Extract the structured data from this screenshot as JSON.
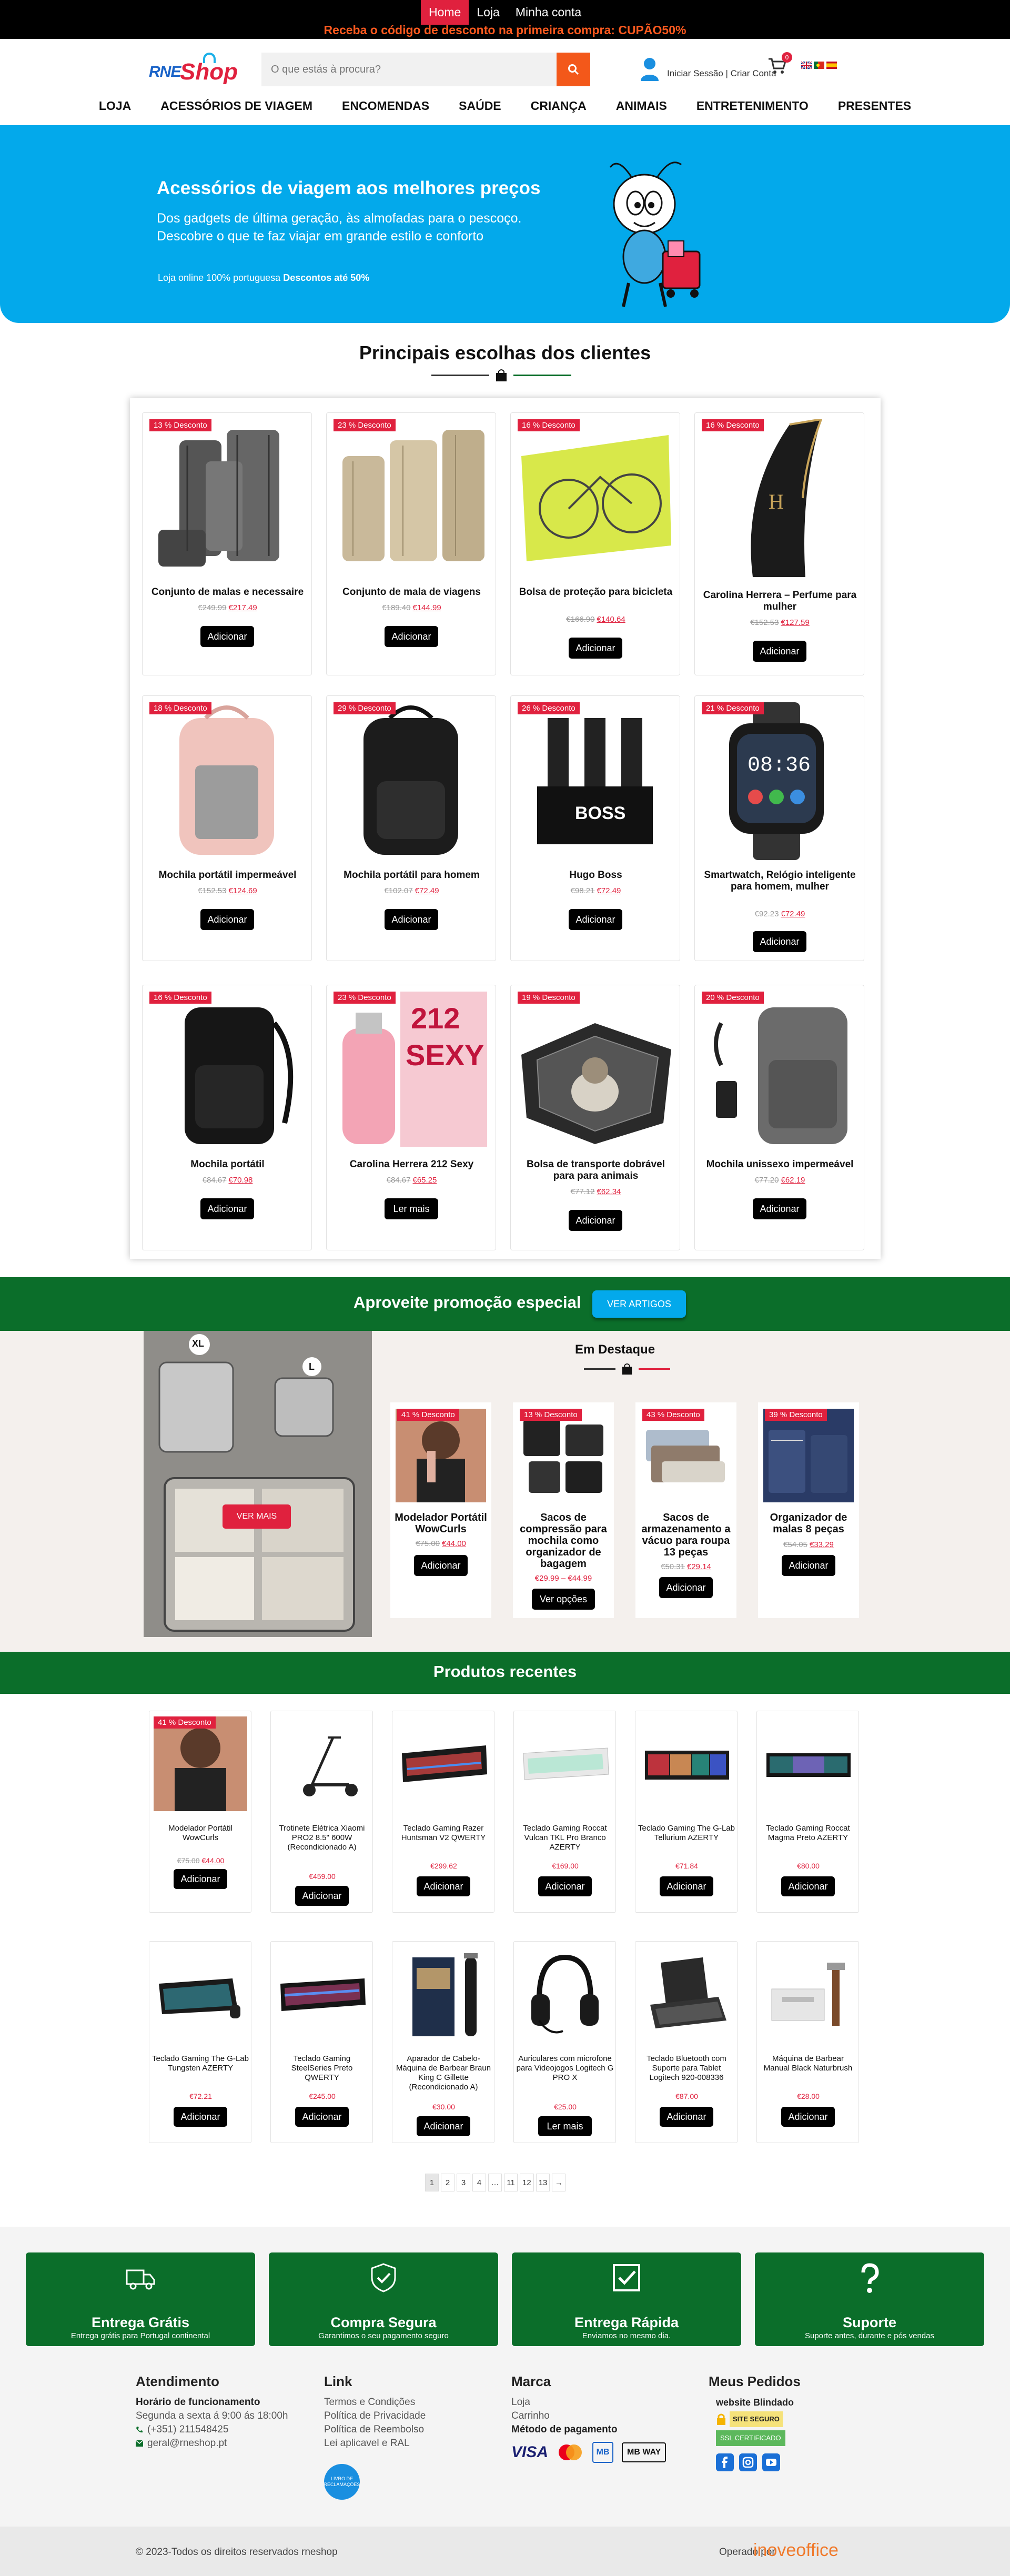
{
  "topbar": {
    "nav": [
      {
        "label": "Home"
      },
      {
        "label": "Loja"
      },
      {
        "label": "Minha conta"
      }
    ],
    "promo": "Receba o código de desconto na primeira compra: CUPÃO50%"
  },
  "header": {
    "logo_rne": "RNE",
    "logo_shop": "Shop",
    "search_placeholder": "O que estás à procura?",
    "account_text": "Iniciar Sessão | Criar Conta",
    "cart_count": "0"
  },
  "mainnav": [
    "LOJA",
    "ACESSÓRIOS DE VIAGEM",
    "ENCOMENDAS",
    "SAÚDE",
    "CRIANÇA",
    "ANIMAIS",
    "ENTRETENIMENTO",
    "PRESENTES"
  ],
  "hero": {
    "title": "Acessórios de viagem aos melhores preços",
    "subtitle": "Dos gadgets de última geração, às almofadas para o pescoço. Descobre o que te faz viajar em grande estilo e conforto",
    "note_prefix": "Loja online 100% portuguesa",
    "note_bold": "Descontos até 50%",
    "accent": "#03a9eb"
  },
  "top_picks": {
    "title": "Principais escolhas dos clientes",
    "products": [
      {
        "discount": "13 % Desconto",
        "name": "Conjunto de malas e necessaire",
        "old": "€249.99",
        "new": "€217.49",
        "button": "Adicionar"
      },
      {
        "discount": "23 % Desconto",
        "name": "Conjunto de mala de viagens",
        "old": "€189.40",
        "new": "€144.99",
        "button": "Adicionar"
      },
      {
        "discount": "16 % Desconto",
        "name": "Bolsa de proteção para bicicleta",
        "old": "€166.90",
        "new": "€140.64",
        "button": "Adicionar"
      },
      {
        "discount": "16 % Desconto",
        "name": "Carolina Herrera – Perfume para mulher",
        "old": "€152.53",
        "new": "€127.59",
        "button": "Adicionar"
      },
      {
        "discount": "18 % Desconto",
        "name": "Mochila portátil impermeável",
        "old": "€152.53",
        "new": "€124.69",
        "button": "Adicionar"
      },
      {
        "discount": "29 % Desconto",
        "name": "Mochila portátil para homem",
        "old": "€102.07",
        "new": "€72.49",
        "button": "Adicionar"
      },
      {
        "discount": "26 % Desconto",
        "name": "Hugo Boss",
        "old": "€98.21",
        "new": "€72.49",
        "button": "Adicionar"
      },
      {
        "discount": "21 % Desconto",
        "name": "Smartwatch, Relógio inteligente para homem, mulher",
        "old": "€92.23",
        "new": "€72.49",
        "button": "Adicionar"
      },
      {
        "discount": "16 % Desconto",
        "name": "Mochila portátil",
        "old": "€84.67",
        "new": "€70.98",
        "button": "Adicionar"
      },
      {
        "discount": "23 % Desconto",
        "name": "Carolina Herrera 212 Sexy",
        "old": "€84.67",
        "new": "€65.25",
        "button": "Ler mais"
      },
      {
        "discount": "19 % Desconto",
        "name": "Bolsa de transporte dobrável para para animais",
        "old": "€77.12",
        "new": "€62.34",
        "button": "Adicionar"
      },
      {
        "discount": "20 % Desconto",
        "name": "Mochila unissexo impermeável",
        "old": "€77.20",
        "new": "€62.19",
        "button": "Adicionar"
      }
    ]
  },
  "promo_band": {
    "title": "Aproveite promoção especial",
    "button": "VER ARTIGOS"
  },
  "featured": {
    "title": "Em Destaque",
    "image_button": "VER MAIS",
    "size_xl": "XL",
    "size_l": "L",
    "products": [
      {
        "discount": "41 % Desconto",
        "name": "Modelador Portátil WowCurls",
        "old": "€75.00",
        "new": "€44.00",
        "button": "Adicionar"
      },
      {
        "discount": "13 % Desconto",
        "name": "Sacos de compressão para mochila como organizador de bagagem",
        "price": "€29.99 – €44.99",
        "button": "Ver opções"
      },
      {
        "discount": "43 % Desconto",
        "name": "Sacos de armazenamento a vácuo para roupa 13 peças",
        "old": "€50.31",
        "new": "€29.14",
        "button": "Adicionar"
      },
      {
        "discount": "39 % Desconto",
        "name": "Organizador de malas 8 peças",
        "old": "€54.05",
        "new": "€33.29",
        "button": "Adicionar"
      }
    ]
  },
  "recent": {
    "title": "Produtos recentes",
    "products": [
      {
        "discount": "41 % Desconto",
        "name": "Modelador Portátil WowCurls",
        "old": "€75.00",
        "new": "€44.00",
        "button": "Adicionar"
      },
      {
        "name": "Trotinete Elétrica Xiaomi PRO2 8.5\" 600W (Recondicionado A)",
        "price": "€459.00",
        "button": "Adicionar"
      },
      {
        "name": "Teclado Gaming Razer Huntsman V2 QWERTY",
        "price": "€299.62",
        "button": "Adicionar"
      },
      {
        "name": "Teclado Gaming Roccat Vulcan TKL Pro Branco AZERTY",
        "price": "€169.00",
        "button": "Adicionar"
      },
      {
        "name": "Teclado Gaming The G-Lab Tellurium AZERTY",
        "price": "€71.84",
        "button": "Adicionar"
      },
      {
        "name": "Teclado Gaming Roccat Magma Preto AZERTY",
        "price": "€80.00",
        "button": "Adicionar"
      },
      {
        "name": "Teclado Gaming The G-Lab Tungsten AZERTY",
        "price": "€72.21",
        "button": "Adicionar"
      },
      {
        "name": "Teclado Gaming SteelSeries Preto QWERTY",
        "price": "€245.00",
        "button": "Adicionar"
      },
      {
        "name": "Aparador de Cabelo-Máquina de Barbear Braun King C Gillette (Recondicionado A)",
        "price": "€30.00",
        "button": "Adicionar"
      },
      {
        "name": "Auriculares com microfone para Videojogos Logitech G PRO X",
        "price": "€25.00",
        "button": "Ler mais"
      },
      {
        "name": "Teclado Bluetooth com Suporte para Tablet Logitech 920-008336",
        "price": "€87.00",
        "button": "Adicionar"
      },
      {
        "name": "Máquina de Barbear Manual Black Naturbrush",
        "price": "€28.00",
        "button": "Adicionar"
      }
    ]
  },
  "pagination": [
    "1",
    "2",
    "3",
    "4",
    "…",
    "11",
    "12",
    "13",
    "→"
  ],
  "features": [
    {
      "icon": "truck-icon",
      "title": "Entrega Grátis",
      "sub": "Entrega grátis para Portugal continental"
    },
    {
      "icon": "shield-check-icon",
      "title": "Compra Segura",
      "sub": "Garantimos o seu pagamento seguro"
    },
    {
      "icon": "checkbox-icon",
      "title": "Entrega Rápida",
      "sub": "Enviamos no mesmo dia."
    },
    {
      "icon": "question-icon",
      "title": "Suporte",
      "sub": "Suporte antes, durante e pós vendas"
    }
  ],
  "footer": {
    "atendimento": {
      "title": "Atendimento",
      "hours_title": "Horário de funcionamento",
      "hours": "Segunda a sexta á 9:00 ás 18:00h",
      "phone": "(+351) 211548425",
      "email": "geral@rneshop.pt"
    },
    "link": {
      "title": "Link",
      "items": [
        "Termos e Condições",
        "Política de Privacidade",
        "Política de Reembolso",
        "Lei aplicavel e RAL"
      ],
      "complaint": "LIVRO DE RECLAMAÇÕES"
    },
    "marca": {
      "title": "Marca",
      "items": [
        "Loja",
        "Carrinho"
      ],
      "payment_title": "Método de pagamento",
      "payments": [
        "VISA",
        "Mastercard",
        "MB",
        "MB WAY"
      ]
    },
    "pedidos": {
      "title": "Meus Pedidos",
      "shield": "website Blindado",
      "safe": "SITE SEGURO",
      "ssl": "SSL CERTIFICADO"
    },
    "copyright": "© 2023-Todos os direitos reservados rneshop",
    "operated": "Operado por",
    "operator": "inoveoffice"
  },
  "colors": {
    "green": "#0b6e2a",
    "red": "#e0213e",
    "blue": "#03a9eb",
    "orange": "#f3581a"
  }
}
